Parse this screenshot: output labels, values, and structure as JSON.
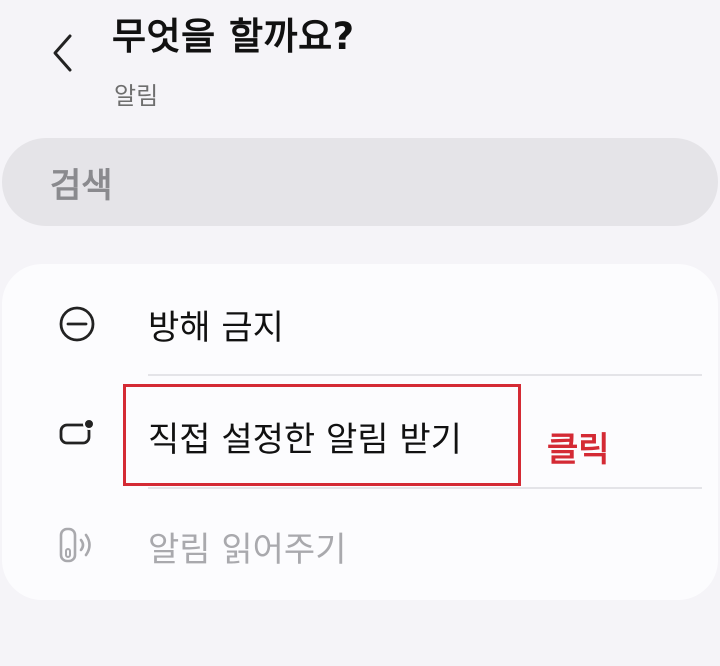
{
  "header": {
    "title": "무엇을 할까요?",
    "subtitle": "알림"
  },
  "search": {
    "placeholder": "검색"
  },
  "menu": {
    "items": [
      {
        "label": "방해 금지",
        "icon": "do-not-disturb-icon",
        "enabled": true
      },
      {
        "label": "직접 설정한 알림 받기",
        "icon": "notification-badge-icon",
        "enabled": true
      },
      {
        "label": "알림 읽어주기",
        "icon": "read-aloud-icon",
        "enabled": false
      }
    ]
  },
  "annotation": {
    "label": "클릭",
    "color": "#d42a34"
  },
  "colors": {
    "background": "#f5f4f8",
    "card": "#fcfcfe",
    "search_bg": "#e5e4e8",
    "disabled_text": "#a9a9ad"
  }
}
